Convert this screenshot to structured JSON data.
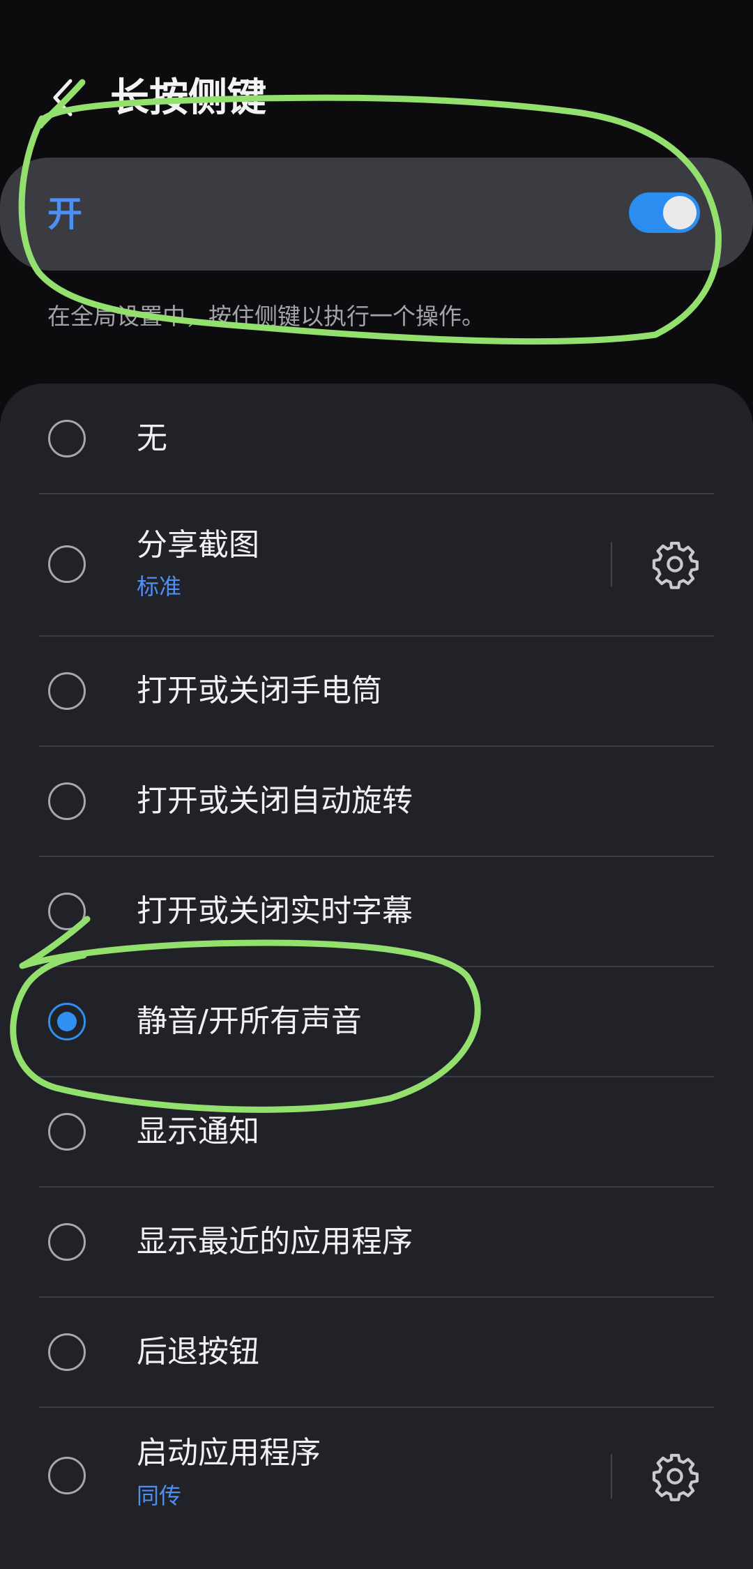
{
  "header": {
    "title": "长按侧键",
    "back_icon": "back-arrow-icon"
  },
  "master_switch": {
    "label": "开",
    "state": "on"
  },
  "description": "在全局设置中，按住侧键以执行一个操作。",
  "options": [
    {
      "label": "无",
      "selected": false
    },
    {
      "label": "分享截图",
      "sub": "标准",
      "selected": false,
      "has_settings": true
    },
    {
      "label": "打开或关闭手电筒",
      "selected": false
    },
    {
      "label": "打开或关闭自动旋转",
      "selected": false
    },
    {
      "label": "打开或关闭实时字幕",
      "selected": false
    },
    {
      "label": "静音/开所有声音",
      "selected": true
    },
    {
      "label": "显示通知",
      "selected": false
    },
    {
      "label": "显示最近的应用程序",
      "selected": false
    },
    {
      "label": "后退按钮",
      "selected": false
    },
    {
      "label": "启动应用程序",
      "sub": "同传",
      "selected": false,
      "has_settings": true
    }
  ],
  "colors": {
    "accent": "#2f90f2",
    "annotation": "#93e06f",
    "background": "#0c0c0e",
    "card": "#212227",
    "switch_card": "#3b3c42"
  }
}
